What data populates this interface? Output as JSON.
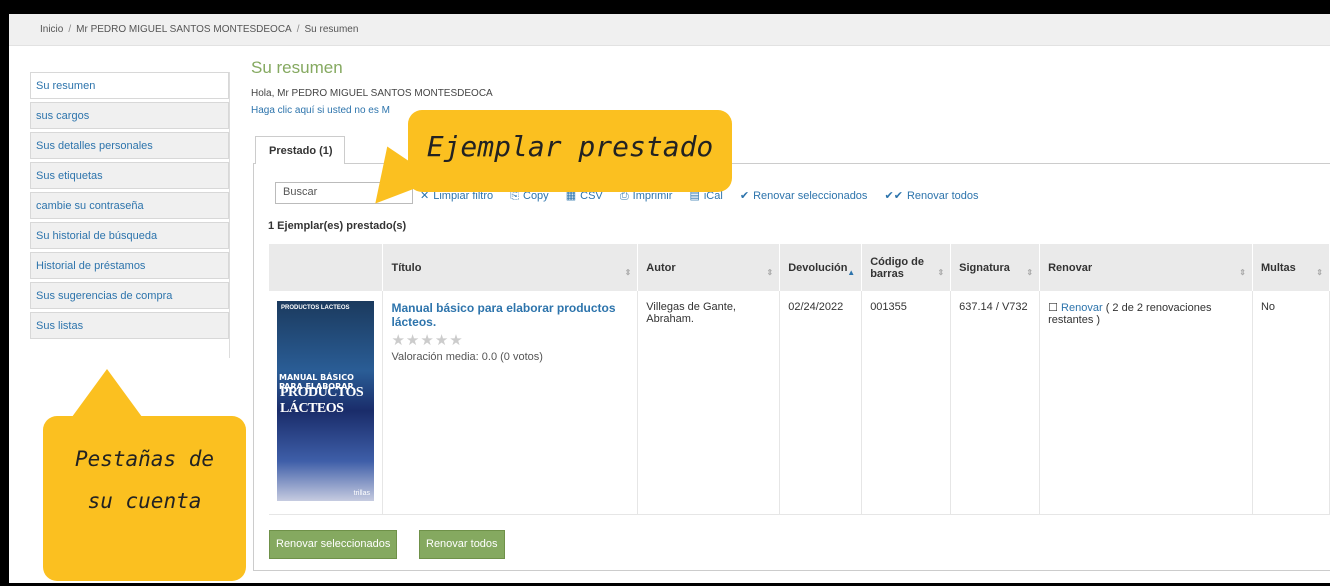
{
  "breadcrumb": {
    "home": "Inicio",
    "user": "Mr PEDRO MIGUEL SANTOS MONTESDEOCA",
    "current": "Su resumen",
    "sep": "/"
  },
  "sidebar": {
    "items": [
      {
        "label": "Su resumen"
      },
      {
        "label": "sus cargos"
      },
      {
        "label": "Sus detalles personales"
      },
      {
        "label": "Sus etiquetas"
      },
      {
        "label": "cambie su contraseña"
      },
      {
        "label": "Su historial de búsqueda"
      },
      {
        "label": "Historial de préstamos"
      },
      {
        "label": "Sus sugerencias de compra"
      },
      {
        "label": "Sus listas"
      }
    ]
  },
  "main": {
    "title": "Su resumen",
    "hello": "Hola, Mr PEDRO MIGUEL SANTOS MONTESDEOCA",
    "not_you": "Haga clic aquí si usted no es M"
  },
  "tabs": [
    {
      "label": "Prestado (1)"
    }
  ],
  "search": {
    "placeholder": "Buscar"
  },
  "toolbar": {
    "clear_filter": "Limpiar filtro",
    "copy": "Copy",
    "csv": "CSV",
    "print": "Imprimir",
    "ical": "iCal",
    "renew_selected": "Renovar seleccionados",
    "renew_all": "Renovar todos"
  },
  "count": "1 Ejemplar(es) prestado(s)",
  "table": {
    "headers": [
      "Título",
      "Autor",
      "Devolución",
      "Código de barras",
      "Signatura",
      "Renovar",
      "Multas"
    ],
    "rows": [
      {
        "title": "Manual básico para elaborar productos lácteos.",
        "rating_stars": 0,
        "rating_text": "Valoración media: 0.0 (0 votos)",
        "author": "Villegas de Gante, Abraham.",
        "due": "02/24/2022",
        "barcode": "001355",
        "call_number": "637.14 / V732",
        "renew_link": "Renovar",
        "renew_note": "( 2 de 2 renovaciones restantes )",
        "fines": "No"
      }
    ]
  },
  "cover": {
    "small_title": "PRODUCTOS LACTEOS",
    "line1": "MANUAL BÁSICO PARA ELABORAR",
    "line2": "PRODUCTOS LÁCTEOS",
    "publisher": "trillas"
  },
  "buttons": {
    "renew_selected": "Renovar seleccionados",
    "renew_all": "Renovar todos"
  },
  "callouts": {
    "loaned": "Ejemplar prestado",
    "tabs_1": "Pestañas de",
    "tabs_2": "su cuenta"
  },
  "colors": {
    "accent_green": "#85a960",
    "link_blue": "#2d74ac",
    "callout_yellow": "#fbc020"
  }
}
